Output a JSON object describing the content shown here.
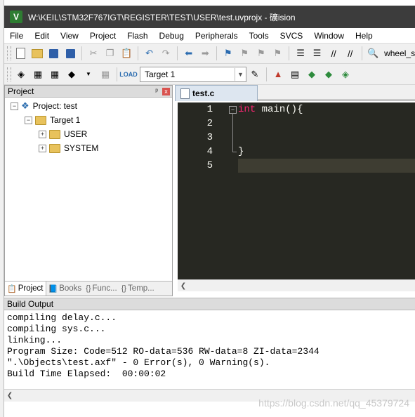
{
  "window": {
    "app_icon_letter": "V",
    "title": "W:\\KEIL\\STM32F767IGT\\REGISTER\\TEST\\USER\\test.uvprojx - 礦ision"
  },
  "menu": [
    "File",
    "Edit",
    "View",
    "Project",
    "Flash",
    "Debug",
    "Peripherals",
    "Tools",
    "SVCS",
    "Window",
    "Help"
  ],
  "toolbar1": {
    "search_value": "wheel_s"
  },
  "toolbar2": {
    "target_value": "Target 1"
  },
  "project_panel": {
    "title": "Project",
    "pin_glyph": "ᵖ",
    "close_glyph": "x",
    "tree": {
      "root": "Project: test",
      "target": "Target 1",
      "groups": [
        "USER",
        "SYSTEM"
      ]
    },
    "tabs": [
      {
        "icon": "📋",
        "label": "Project"
      },
      {
        "icon": "📘",
        "label": "Books"
      },
      {
        "icon": "{}",
        "label": "Func..."
      },
      {
        "icon": "{}",
        "label": "Temp..."
      }
    ]
  },
  "editor": {
    "tab_label": "test.c",
    "line_numbers": [
      "1",
      "2",
      "3",
      "4",
      "5"
    ],
    "lines": [
      {
        "keyword": "int",
        "rest": " main(){"
      },
      {
        "keyword": "",
        "rest": ""
      },
      {
        "keyword": "",
        "rest": ""
      },
      {
        "keyword": "",
        "rest": "}"
      },
      {
        "keyword": "",
        "rest": ""
      }
    ],
    "theme": {
      "background": "#272822",
      "keyword": "#f92672",
      "text": "#f8f8f2",
      "current_line": "#3e3d32"
    }
  },
  "build_output": {
    "title": "Build Output",
    "lines": [
      "compiling delay.c...",
      "compiling sys.c...",
      "linking...",
      "Program Size: Code=512 RO-data=536 RW-data=8 ZI-data=2344",
      "\".\\Objects\\test.axf\" - 0 Error(s), 0 Warning(s).",
      "Build Time Elapsed:  00:00:02"
    ]
  },
  "watermark": "https://blog.csdn.net/qq_45379724"
}
